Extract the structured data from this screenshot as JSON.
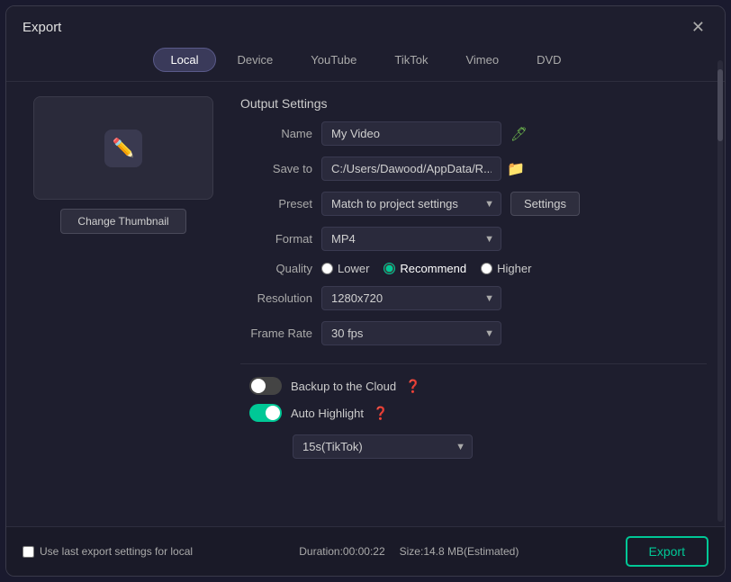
{
  "dialog": {
    "title": "Export",
    "close_label": "✕"
  },
  "tabs": [
    {
      "id": "local",
      "label": "Local",
      "active": true
    },
    {
      "id": "device",
      "label": "Device",
      "active": false
    },
    {
      "id": "youtube",
      "label": "YouTube",
      "active": false
    },
    {
      "id": "tiktok",
      "label": "TikTok",
      "active": false
    },
    {
      "id": "vimeo",
      "label": "Vimeo",
      "active": false
    },
    {
      "id": "dvd",
      "label": "DVD",
      "active": false
    }
  ],
  "thumbnail": {
    "change_label": "Change Thumbnail"
  },
  "output_settings": {
    "section_title": "Output Settings",
    "name_label": "Name",
    "name_value": "My Video",
    "save_to_label": "Save to",
    "save_to_value": "C:/Users/Dawood/AppData/R...",
    "preset_label": "Preset",
    "preset_value": "Match to project settings",
    "settings_label": "Settings",
    "format_label": "Format",
    "format_value": "MP4",
    "quality_label": "Quality",
    "quality_options": [
      {
        "id": "lower",
        "label": "Lower",
        "checked": false
      },
      {
        "id": "recommend",
        "label": "Recommend",
        "checked": true
      },
      {
        "id": "higher",
        "label": "Higher",
        "checked": false
      }
    ],
    "resolution_label": "Resolution",
    "resolution_value": "1280x720",
    "frame_rate_label": "Frame Rate",
    "frame_rate_value": "30 fps",
    "backup_label": "Backup to the Cloud",
    "backup_on": false,
    "auto_highlight_label": "Auto Highlight",
    "auto_highlight_on": true,
    "highlight_duration": "15s(TikTok)"
  },
  "footer": {
    "checkbox_label": "Use last export settings for local",
    "duration_label": "Duration:00:00:22",
    "size_label": "Size:14.8 MB(Estimated)",
    "export_label": "Export"
  }
}
